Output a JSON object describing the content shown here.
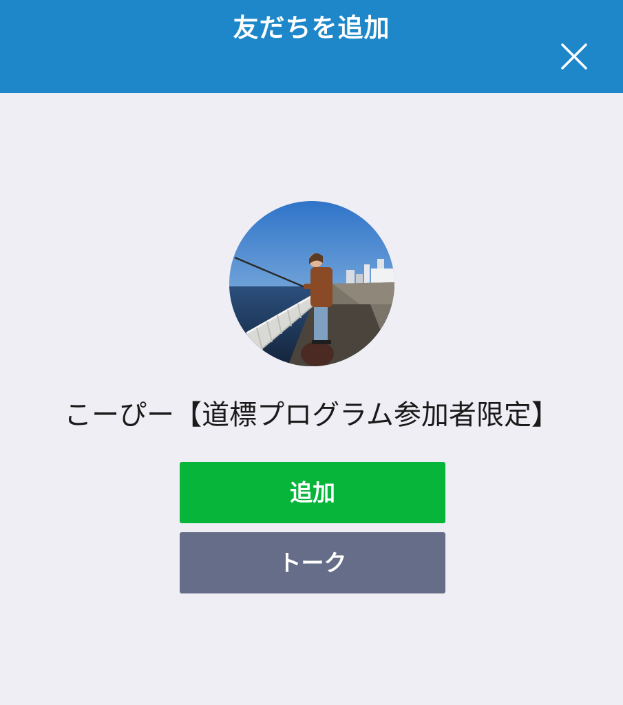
{
  "header": {
    "title": "友だちを追加",
    "close_icon": "close-icon",
    "background_color": "#1d87c9"
  },
  "profile": {
    "avatar_description_icon": "profile-photo",
    "display_name": "こーぴー【道標プログラム参加者限定】"
  },
  "actions": {
    "add_label": "追加",
    "add_color": "#07b53b",
    "talk_label": "トーク",
    "talk_color": "#656d88"
  },
  "page": {
    "background_color": "#efeef4"
  }
}
